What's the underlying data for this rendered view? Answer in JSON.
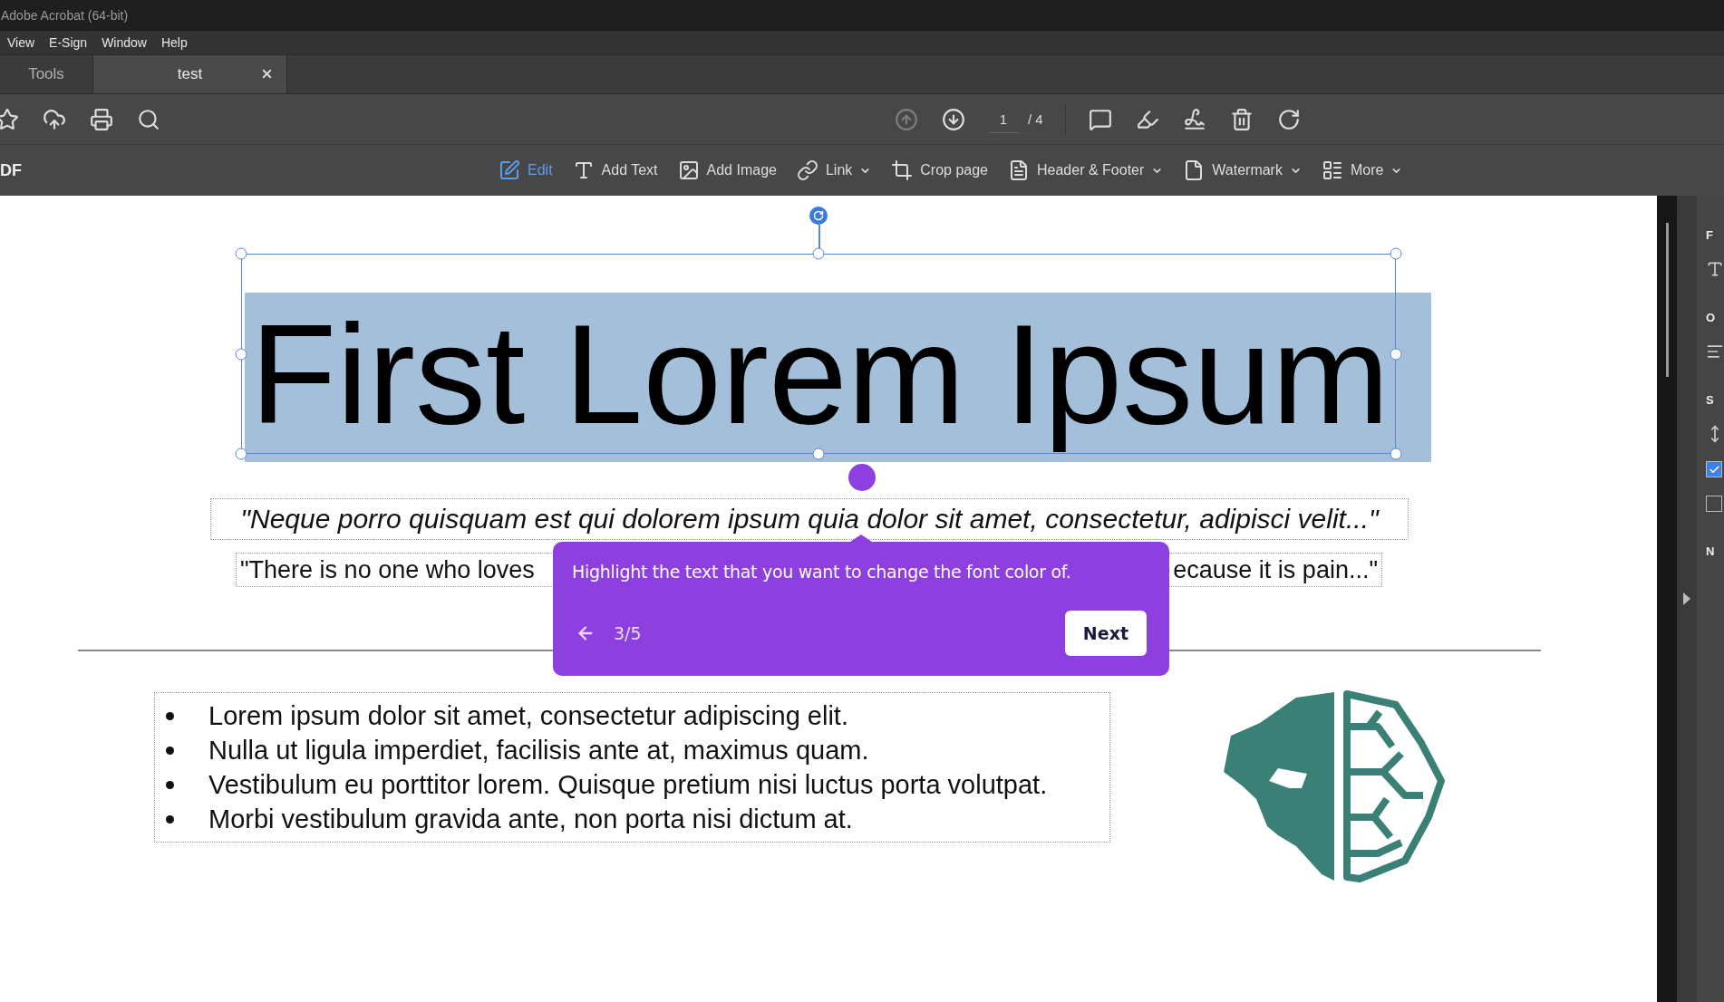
{
  "window": {
    "title": "Adobe Acrobat (64-bit)"
  },
  "menu": [
    "View",
    "E-Sign",
    "Window",
    "Help"
  ],
  "tabs": [
    {
      "label": "Tools",
      "selected": false,
      "closable": false
    },
    {
      "label": "test",
      "selected": true,
      "closable": true
    }
  ],
  "toolbar": {
    "page": "1",
    "page_total": "/ 4",
    "prev_disabled": true
  },
  "edit_bar": {
    "label": "DF",
    "tools": [
      {
        "kind": "edit",
        "label": "Edit",
        "selected": true,
        "dropdown": false
      },
      {
        "kind": "text",
        "label": "Add Text",
        "selected": false,
        "dropdown": false
      },
      {
        "kind": "image",
        "label": "Add Image",
        "selected": false,
        "dropdown": false
      },
      {
        "kind": "link",
        "label": "Link",
        "selected": false,
        "dropdown": true
      },
      {
        "kind": "crop",
        "label": "Crop page",
        "selected": false,
        "dropdown": false
      },
      {
        "kind": "header",
        "label": "Header & Footer",
        "selected": false,
        "dropdown": true
      },
      {
        "kind": "watermark",
        "label": "Watermark",
        "selected": false,
        "dropdown": true
      },
      {
        "kind": "more",
        "label": "More",
        "selected": false,
        "dropdown": true
      }
    ]
  },
  "document": {
    "title": "First Lorem Ipsum",
    "quote": "\"Neque porro quisquam est qui dolorem ipsum quia dolor sit amet, consectetur, adipisci velit...\"",
    "quote_2_left": "\"There is no one who loves",
    "quote_2_right": "ecause it is pain...\"",
    "bullets": [
      "Lorem ipsum dolor sit amet, consectetur adipiscing elit.",
      "Nulla ut ligula imperdiet, facilisis ante at, maximus quam.",
      "Vestibulum eu porttitor lorem. Quisque pretium nisi luctus porta volutpat.",
      "Morbi vestibulum gravida ante, non porta nisi dictum at."
    ]
  },
  "tooltip": {
    "text": "Highlight the text that you want to change the font color of.",
    "step": "3/5",
    "button": "Next"
  },
  "right_panel": {
    "headings": [
      "F",
      "O",
      "S",
      "N"
    ],
    "checkboxes": [
      {
        "checked": true
      },
      {
        "checked": false
      }
    ]
  }
}
